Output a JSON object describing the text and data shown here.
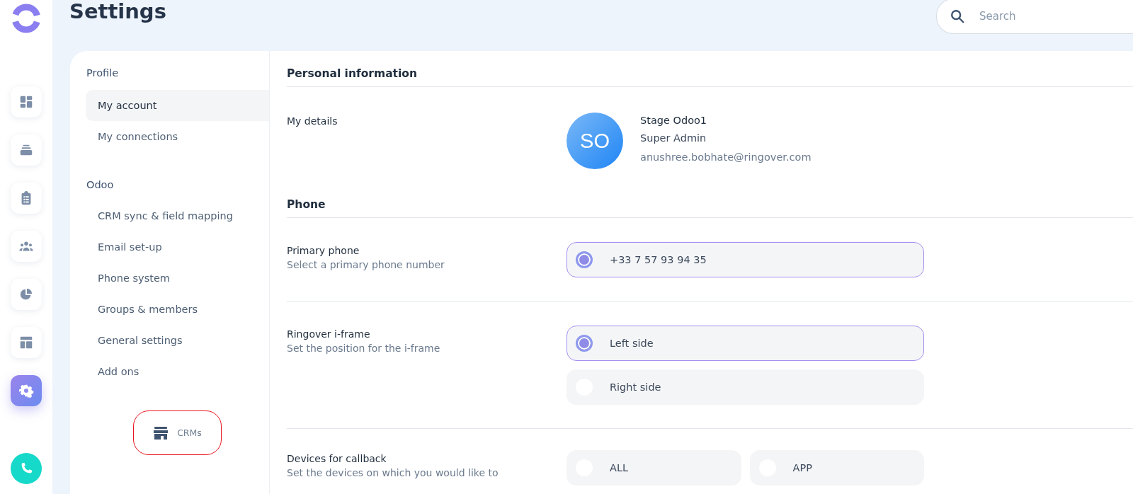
{
  "rail": {
    "items": [
      {
        "kind": "dashboard",
        "selected": false
      },
      {
        "kind": "stack",
        "selected": false
      },
      {
        "kind": "clipboard",
        "selected": false
      },
      {
        "kind": "people",
        "selected": false
      },
      {
        "kind": "pie",
        "selected": false
      },
      {
        "kind": "layout",
        "selected": false
      },
      {
        "kind": "settings",
        "selected": true
      }
    ],
    "call_button": {
      "kind": "phone"
    }
  },
  "header": {
    "title": "Settings",
    "search": {
      "placeholder": "Search"
    }
  },
  "nav": {
    "groups": [
      {
        "title": "Profile",
        "items": [
          {
            "label": "My account",
            "selected": true
          },
          {
            "label": "My connections",
            "selected": false
          }
        ]
      },
      {
        "title": "Odoo",
        "items": [
          {
            "label": "CRM sync & field mapping",
            "selected": false
          },
          {
            "label": "Email set-up",
            "selected": false
          },
          {
            "label": "Phone system",
            "selected": false
          },
          {
            "label": "Groups & members",
            "selected": false
          },
          {
            "label": "General settings",
            "selected": false
          },
          {
            "label": "Add ons",
            "selected": false
          }
        ]
      }
    ],
    "crms_button": {
      "label": "CRMs",
      "highlighted": true
    }
  },
  "sections": [
    {
      "title": "Personal information",
      "rows": [
        {
          "kind": "profile",
          "label": "My details",
          "avatar_initials": "SO",
          "name": "Stage Odoo1",
          "role": "Super Admin",
          "email": "anushree.bobhate@ringover.com"
        }
      ]
    },
    {
      "title": "Phone",
      "rows": [
        {
          "kind": "radiolist",
          "label": "Primary phone",
          "description": "Select a primary phone number",
          "options": [
            {
              "label": "+33 7 57 93 94 35",
              "selected": true
            }
          ]
        },
        {
          "kind": "radiolist",
          "label": "Ringover i-frame",
          "description": "Set the position for the i-frame",
          "options": [
            {
              "label": "Left side",
              "selected": true
            },
            {
              "label": "Right side",
              "selected": false
            }
          ]
        },
        {
          "kind": "radiorow",
          "label": "Devices for callback",
          "description": "Set the devices on which you would like to",
          "options": [
            {
              "label": "ALL",
              "selected": false
            },
            {
              "label": "APP",
              "selected": false
            }
          ]
        }
      ]
    }
  ]
}
